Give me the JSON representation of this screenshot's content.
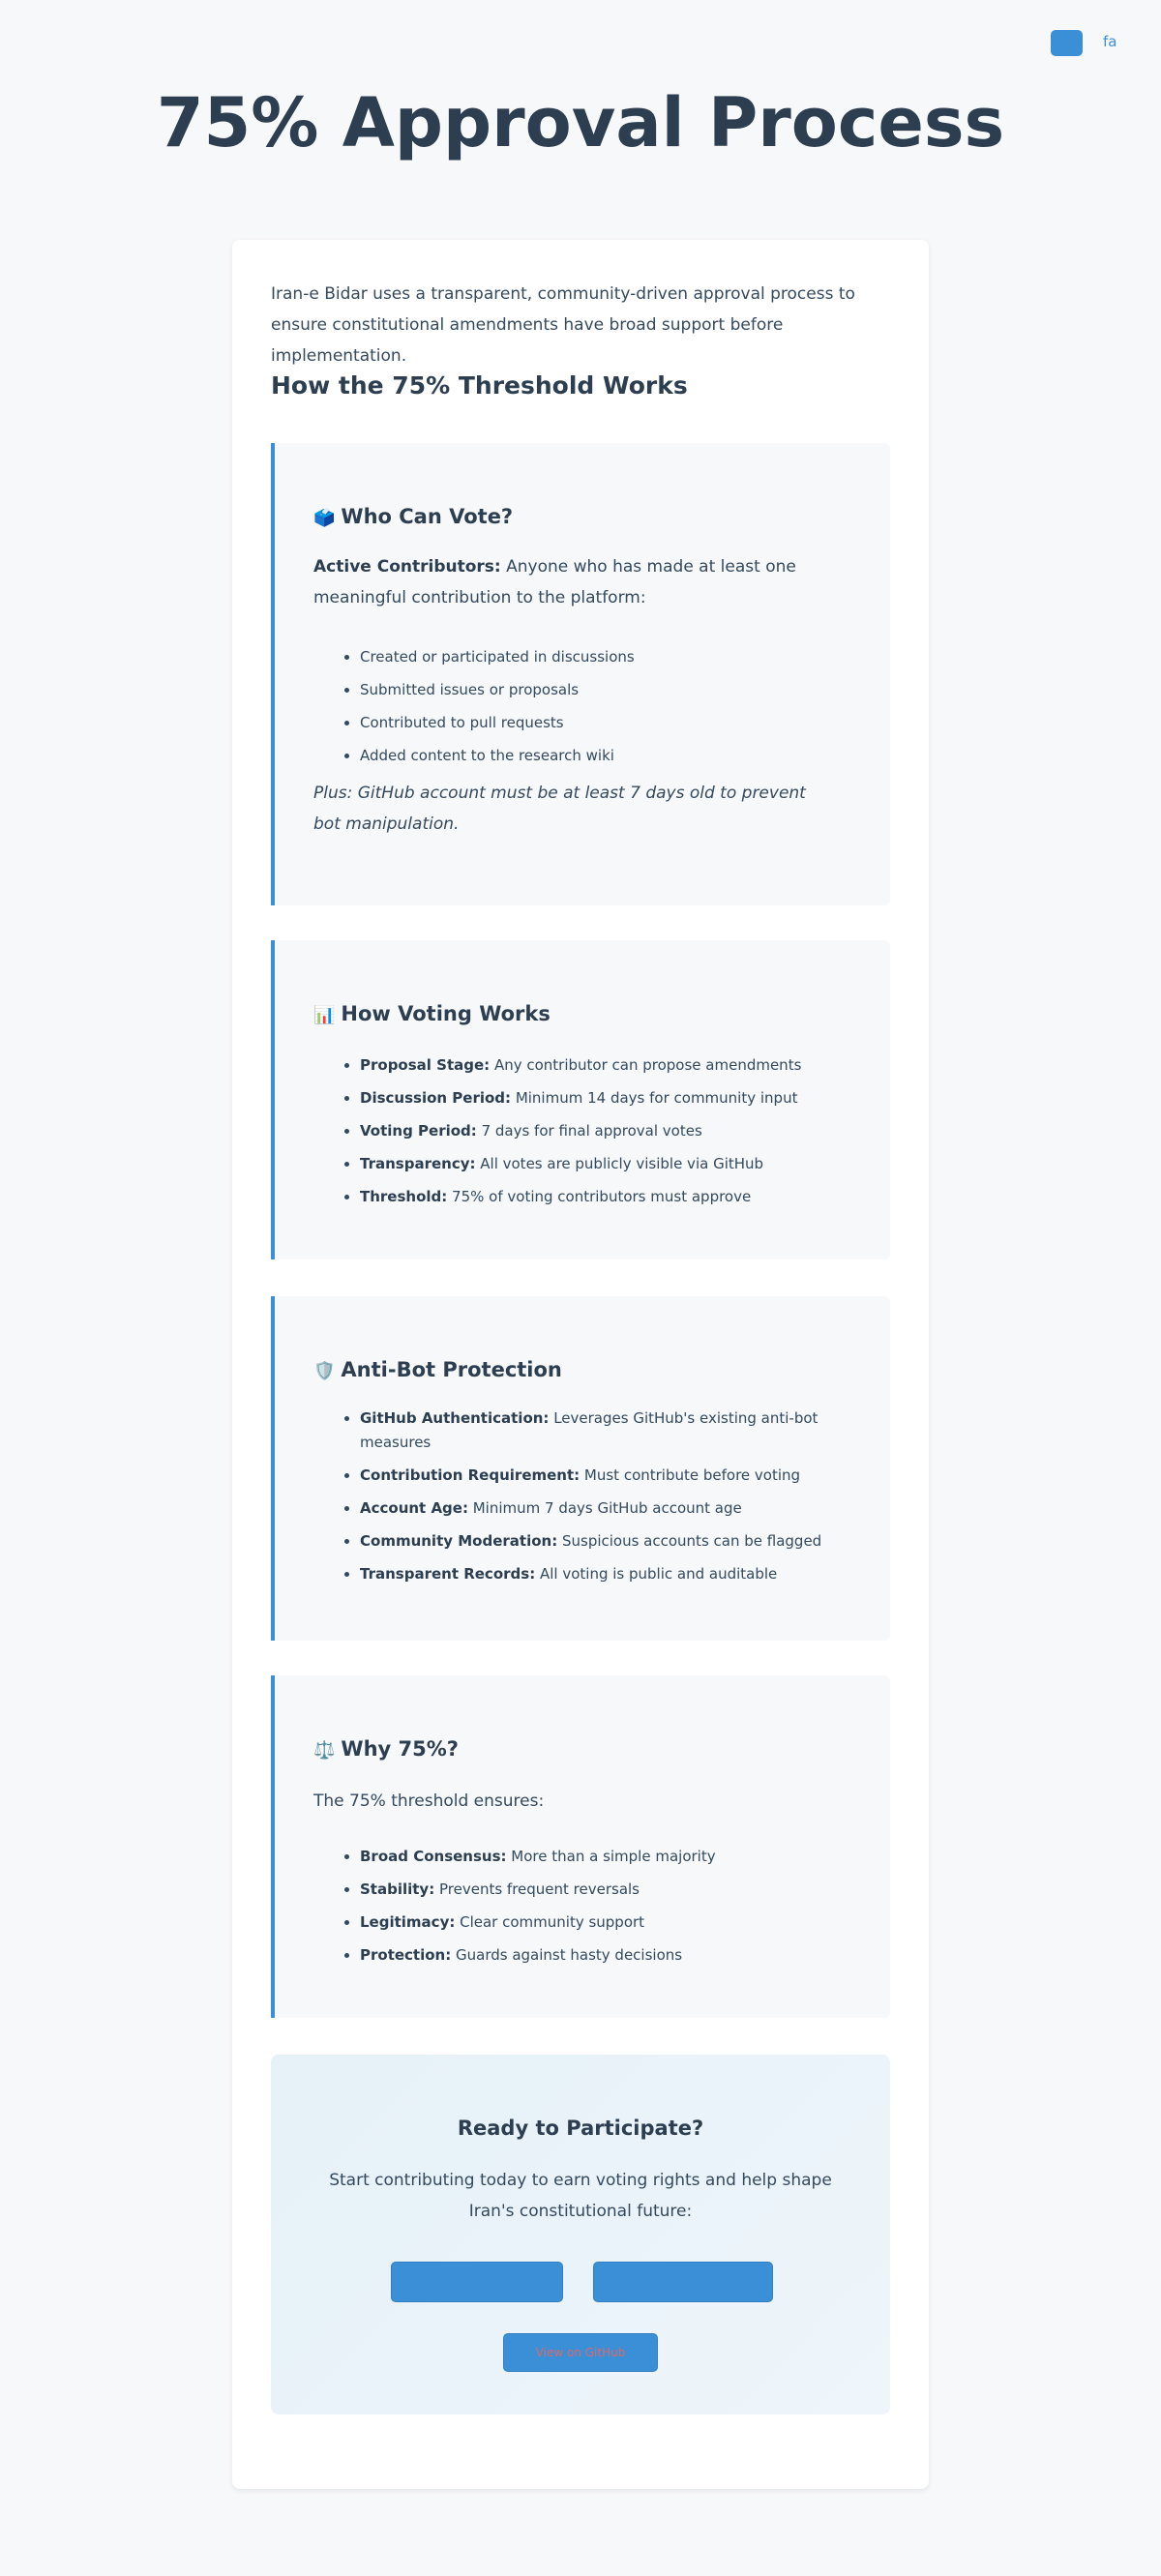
{
  "header": {
    "lang_link": "fa"
  },
  "page_title": "75% Approval Process",
  "intro": "Iran-e Bidar uses a transparent, community-driven approval process to ensure constitutional amendments have broad support before implementation.",
  "section_title": "How the 75% Threshold Works",
  "who_can_vote": {
    "emoji": "🗳️",
    "title": "Who Can Vote?",
    "lead_bold": "Active Contributors:",
    "lead_text": " Anyone who has made at least one meaningful contribution to the platform:",
    "items": [
      "Created or participated in discussions",
      "Submitted issues or proposals",
      "Contributed to pull requests",
      "Added content to the research wiki"
    ],
    "note": "Plus: GitHub account must be at least 7 days old to prevent bot manipulation."
  },
  "how_voting_works": {
    "emoji": "📊",
    "title": "How Voting Works",
    "items": [
      {
        "bold": "Proposal Stage:",
        "text": " Any contributor can propose amendments"
      },
      {
        "bold": "Discussion Period:",
        "text": " Minimum 14 days for community input"
      },
      {
        "bold": "Voting Period:",
        "text": " 7 days for final approval votes"
      },
      {
        "bold": "Transparency:",
        "text": " All votes are publicly visible via GitHub"
      },
      {
        "bold": "Threshold:",
        "text": " 75% of voting contributors must approve"
      }
    ]
  },
  "anti_bot": {
    "emoji": "🛡️",
    "title": "Anti-Bot Protection",
    "items": [
      {
        "bold": "GitHub Authentication:",
        "text": " Leverages GitHub's existing anti-bot measures"
      },
      {
        "bold": "Contribution Requirement:",
        "text": " Must contribute before voting"
      },
      {
        "bold": "Account Age:",
        "text": " Minimum 7 days GitHub account age"
      },
      {
        "bold": "Community Moderation:",
        "text": " Suspicious accounts can be flagged"
      },
      {
        "bold": "Transparent Records:",
        "text": " All voting is public and auditable"
      }
    ]
  },
  "why_75": {
    "emoji": "⚖️",
    "title": "Why 75%?",
    "lead": "The 75% threshold ensures:",
    "items": [
      {
        "bold": "Broad Consensus:",
        "text": " More than a simple majority"
      },
      {
        "bold": "Stability:",
        "text": " Prevents frequent reversals"
      },
      {
        "bold": "Legitimacy:",
        "text": " Clear community support"
      },
      {
        "bold": "Protection:",
        "text": " Guards against hasty decisions"
      }
    ]
  },
  "cta": {
    "title": "Ready to Participate?",
    "text": "Start contributing today to earn voting rights and help shape Iran's constitutional future:",
    "small_link": "View on GitHub"
  },
  "colors": {
    "accent": "#3b8fd6",
    "text": "#2c3e50",
    "box_bg": "#f6f8fa"
  }
}
